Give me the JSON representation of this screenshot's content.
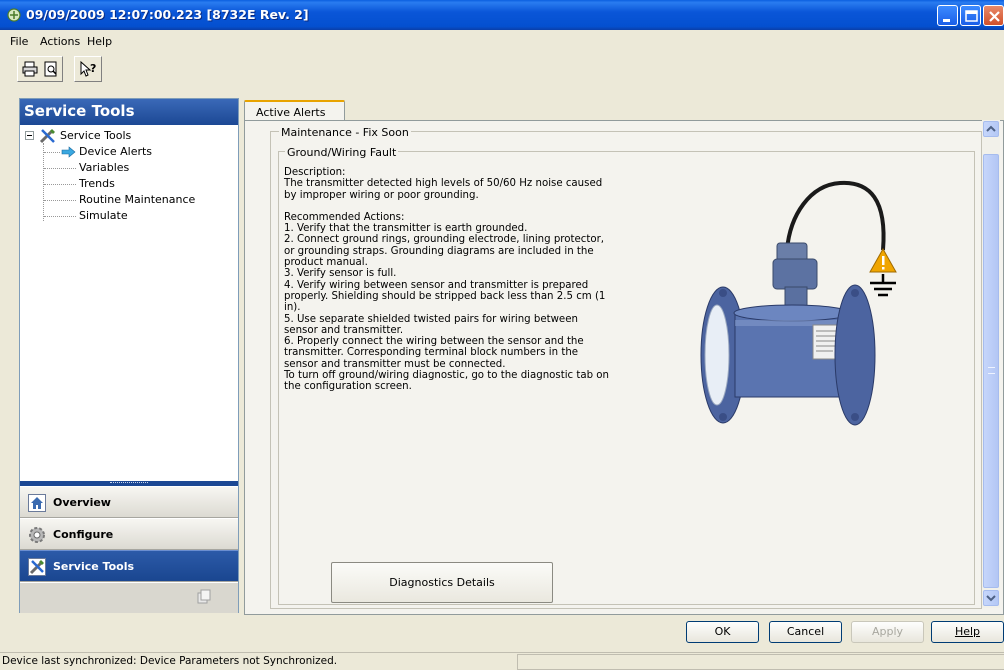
{
  "window": {
    "title": "09/09/2009 12:07:00.223 [8732E Rev. 2]",
    "controls": [
      "minimize-icon",
      "maximize-icon",
      "close-icon"
    ]
  },
  "menu": {
    "items": [
      "File",
      "Actions",
      "Help"
    ]
  },
  "toolbar": {
    "icons": [
      "printer-icon",
      "print-preview-icon",
      "context-help-icon"
    ]
  },
  "sidebar": {
    "header": "Service Tools",
    "tree": {
      "root": "Service Tools",
      "items": [
        "Device Alerts",
        "Variables",
        "Trends",
        "Routine Maintenance",
        "Simulate"
      ],
      "selected": "Device Alerts"
    },
    "nav": [
      {
        "label": "Overview",
        "icon": "home-icon"
      },
      {
        "label": "Configure",
        "icon": "gear-icon"
      },
      {
        "label": "Service Tools",
        "icon": "tools-icon",
        "active": true
      }
    ]
  },
  "content": {
    "tab": "Active Alerts",
    "outer_group": "Maintenance - Fix Soon",
    "inner_group": "Ground/Wiring Fault",
    "description_label": "Description:",
    "description": "The transmitter detected high levels of 50/60 Hz noise caused by improper wiring or poor grounding.",
    "actions_label": "Recommended Actions:",
    "actions": [
      "1. Verify that the transmitter is earth grounded.",
      "2. Connect ground rings, grounding electrode, lining protector, or grounding straps. Grounding diagrams are included in the product manual.",
      "3. Verify sensor is full.",
      "4. Verify wiring between sensor and transmitter is prepared properly. Shielding should be stripped back less than 2.5 cm (1 in).",
      "5. Use separate shielded twisted pairs for wiring between sensor and transmitter.",
      "6. Properly connect the wiring between the sensor and the transmitter. Corresponding terminal block numbers in the sensor and transmitter must be connected.",
      "To turn off ground/wiring diagnostic, go to the diagnostic tab on the configuration screen."
    ],
    "diagnostics_button": "Diagnostics Details"
  },
  "dialog": {
    "ok": "OK",
    "cancel": "Cancel",
    "apply": "Apply",
    "help": "Help"
  },
  "status": {
    "text": "Device last synchronized: Device Parameters not Synchronized."
  },
  "colors": {
    "titlebar": "#0a56d8",
    "sidebar_header": "#1c4894",
    "warning": "#f0a500"
  }
}
